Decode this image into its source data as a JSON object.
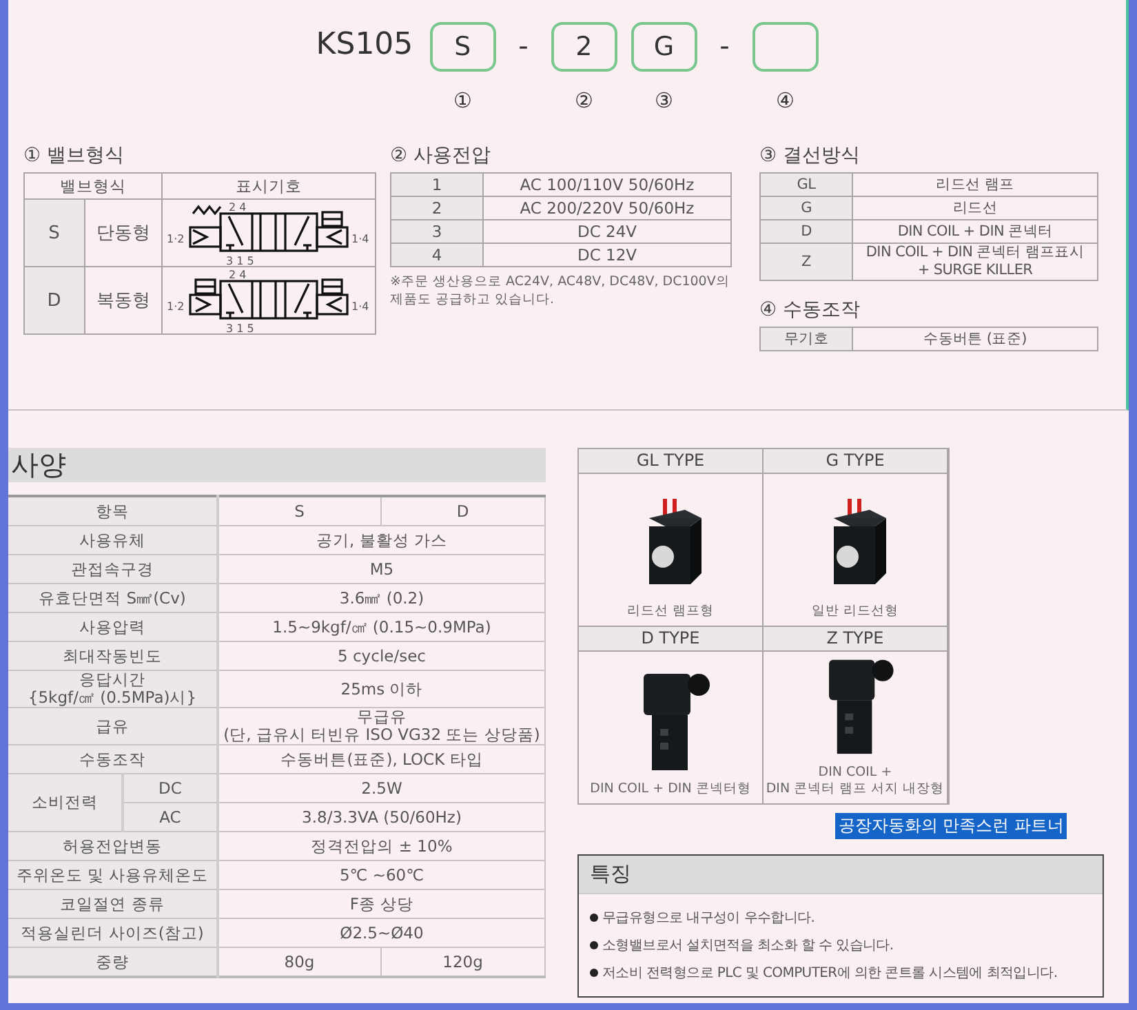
{
  "model": {
    "prefix": "KS105",
    "parts": [
      {
        "kind": "box",
        "value": "S",
        "index": "①"
      },
      {
        "kind": "dash",
        "value": "-"
      },
      {
        "kind": "box",
        "value": "2",
        "index": "②"
      },
      {
        "kind": "box",
        "value": "G",
        "index": "③"
      },
      {
        "kind": "dash",
        "value": "-"
      },
      {
        "kind": "box",
        "index": "④"
      }
    ]
  },
  "valve_type": {
    "title": "① 밸브형식",
    "headers": [
      "밸브형식",
      "표시기호"
    ],
    "rows": [
      {
        "code": "S",
        "name": "단동형",
        "symbol": {
          "kind": "single",
          "top": "2  4",
          "bottom": "3 1 5",
          "left": "1·2",
          "right": "1·4"
        }
      },
      {
        "code": "D",
        "name": "복동형",
        "symbol": {
          "kind": "double",
          "top": "2  4",
          "bottom": "3 1 5",
          "left": "1·2",
          "right": "1·4"
        }
      }
    ]
  },
  "voltage": {
    "title": "② 사용전압",
    "rows": [
      {
        "code": "1",
        "value": "AC 100/110V 50/60Hz"
      },
      {
        "code": "2",
        "value": "AC 200/220V 50/60Hz"
      },
      {
        "code": "3",
        "value": "DC 24V"
      },
      {
        "code": "4",
        "value": "DC 12V"
      }
    ],
    "note": "※주문 생산용으로 AC24V, AC48V, DC48V, DC100V의 제품도 공급하고 있습니다."
  },
  "wiring": {
    "title": "③ 결선방식",
    "rows": [
      {
        "code": "GL",
        "value": "리드선 램프"
      },
      {
        "code": "G",
        "value": "리드선"
      },
      {
        "code": "D",
        "value": "DIN COIL + DIN 콘넥터"
      },
      {
        "code": "Z",
        "value": "DIN COIL + DIN 콘넥터 램프표시\n+ SURGE KILLER"
      }
    ]
  },
  "manual": {
    "title": "④ 수동조작",
    "rows": [
      {
        "code": "무기호",
        "value": "수동버튼 (표준)"
      }
    ]
  },
  "spec": {
    "title": "사양",
    "header": [
      "항목",
      "S",
      "D"
    ],
    "rows": [
      {
        "kind": "row",
        "label": "사용유체",
        "values": [
          "공기, 불활성 가스"
        ]
      },
      {
        "kind": "row",
        "label": "관접속구경",
        "values": [
          "M5"
        ]
      },
      {
        "kind": "row",
        "label": "유효단면적 S㎟(Cv)",
        "values": [
          "3.6㎟ (0.2)"
        ]
      },
      {
        "kind": "row",
        "label": "사용압력",
        "values": [
          "1.5~9kgf/㎠ (0.15~0.9MPa)"
        ]
      },
      {
        "kind": "row",
        "label": "최대작동빈도",
        "values": [
          "5 cycle/sec"
        ]
      },
      {
        "kind": "row",
        "label": "응답시간\n{5kgf/㎠ (0.5MPa)시}",
        "values": [
          "25ms 이하"
        ]
      },
      {
        "kind": "row",
        "label": "급유",
        "values": [
          "무급유\n(단, 급유시 터빈유 ISO VG32 또는 상당품)"
        ]
      },
      {
        "kind": "row",
        "label": "수동조작",
        "values": [
          "수동버튼(표준), LOCK 타입"
        ]
      },
      {
        "kind": "group",
        "label": "소비전력",
        "sub": [
          {
            "label": "DC",
            "value": "2.5W"
          },
          {
            "label": "AC",
            "value": "3.8/3.3VA (50/60Hz)"
          }
        ]
      },
      {
        "kind": "row",
        "label": "허용전압변동",
        "values": [
          "정격전압의 ± 10%"
        ]
      },
      {
        "kind": "row",
        "label": "주위온도 및 사용유체온도",
        "values": [
          "5℃ ~60℃"
        ]
      },
      {
        "kind": "row",
        "label": "코일절연 종류",
        "values": [
          "F종 상당"
        ]
      },
      {
        "kind": "row",
        "label": "적용실린더 사이즈(참고)",
        "values": [
          "Ø2.5~Ø40"
        ]
      },
      {
        "kind": "row",
        "label": "중량",
        "values": [
          "80g",
          "120g"
        ]
      }
    ]
  },
  "types": [
    {
      "title": "GL TYPE",
      "kind": "lead",
      "caption": "리드선 램프형"
    },
    {
      "title": "G TYPE",
      "kind": "lead",
      "caption": "일반 리드선형"
    },
    {
      "title": "D TYPE",
      "kind": "din",
      "caption": "DIN COIL + DIN 콘넥터형"
    },
    {
      "title": "Z TYPE",
      "kind": "din",
      "caption": "DIN COIL +\nDIN 콘넥터 램프 서지 내장형"
    }
  ],
  "tagline": {
    "text": "공장자동화의 만족스런 파트너",
    "highlighted": true
  },
  "features": {
    "title": "특징",
    "items": [
      "무급유형으로 내구성이 우수합니다.",
      "소형밸브로서 설치면적을 최소화 할 수 있습니다.",
      "저소비 전력형으로 PLC 및 COMPUTER에 의한 콘트롤 시스템에 최적입니다."
    ]
  }
}
